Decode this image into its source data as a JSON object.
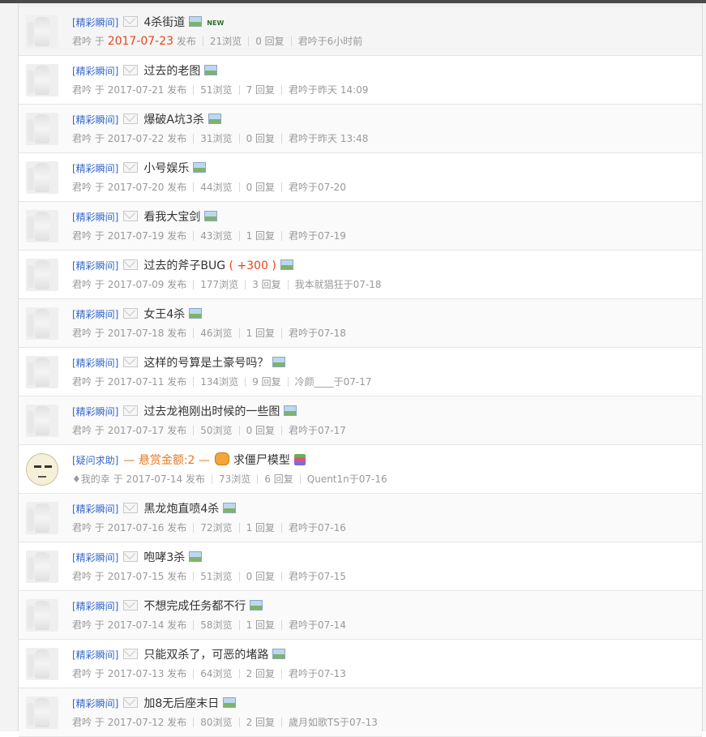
{
  "threads": [
    {
      "tag": "[精彩瞬间]",
      "title": "4杀街道",
      "new_badge": "NEW",
      "author": "君吟",
      "yu": "于",
      "date": "2017-07-23",
      "post_word": "发布",
      "views": "21浏览",
      "replies": "0 回复",
      "last": "君吟于6小时前",
      "icon": "image-icon",
      "hot": true
    },
    {
      "tag": "[精彩瞬间]",
      "title": "过去的老图",
      "author": "君吟",
      "yu": "于",
      "date": "2017-07-21",
      "post_word": "发布",
      "views": "51浏览",
      "replies": "7 回复",
      "last": "君吟于昨天 14:09",
      "icon": "image-icon"
    },
    {
      "tag": "[精彩瞬间]",
      "title": "爆破A坑3杀",
      "author": "君吟",
      "yu": "于",
      "date": "2017-07-22",
      "post_word": "发布",
      "views": "31浏览",
      "replies": "0 回复",
      "last": "君吟于昨天 13:48",
      "icon": "image-icon"
    },
    {
      "tag": "[精彩瞬间]",
      "title": "小号娱乐",
      "author": "君吟",
      "yu": "于",
      "date": "2017-07-20",
      "post_word": "发布",
      "views": "44浏览",
      "replies": "0 回复",
      "last": "君吟于07-20",
      "icon": "image-icon"
    },
    {
      "tag": "[精彩瞬间]",
      "title": "看我大宝剑",
      "author": "君吟",
      "yu": "于",
      "date": "2017-07-19",
      "post_word": "发布",
      "views": "43浏览",
      "replies": "1 回复",
      "last": "君吟于07-19",
      "icon": "image-icon"
    },
    {
      "tag": "[精彩瞬间]",
      "title": "过去的斧子BUG",
      "plus": "( +300 )",
      "author": "君吟",
      "yu": "于",
      "date": "2017-07-09",
      "post_word": "发布",
      "views": "177浏览",
      "replies": "3 回复",
      "last": "我本就猖狂于07-18",
      "icon": "image-icon"
    },
    {
      "tag": "[精彩瞬间]",
      "title": "女王4杀",
      "author": "君吟",
      "yu": "于",
      "date": "2017-07-18",
      "post_word": "发布",
      "views": "46浏览",
      "replies": "1 回复",
      "last": "君吟于07-18",
      "icon": "image-icon"
    },
    {
      "tag": "[精彩瞬间]",
      "title": "这样的号算是土豪号吗？",
      "author": "君吟",
      "yu": "于",
      "date": "2017-07-11",
      "post_word": "发布",
      "views": "134浏览",
      "replies": "9 回复",
      "last": "冷颜____于07-17",
      "icon": "image-icon"
    },
    {
      "tag": "[精彩瞬间]",
      "title": "过去龙袍刚出时候的一些图",
      "author": "君吟",
      "yu": "于",
      "date": "2017-07-17",
      "post_word": "发布",
      "views": "50浏览",
      "replies": "0 回复",
      "last": "君吟于07-17",
      "icon": "image-icon"
    },
    {
      "tag": "[疑问求助]",
      "reward": "— 悬赏金额:2 —",
      "title": "求僵尸模型",
      "author": "♦我的幸",
      "yu": "于",
      "date": "2017-07-14",
      "post_word": "发布",
      "views": "73浏览",
      "replies": "6 回复",
      "last": "Quent1n于07-16",
      "icon": "stack-icon",
      "question": true
    },
    {
      "tag": "[精彩瞬间]",
      "title": "黑龙炮直喷4杀",
      "author": "君吟",
      "yu": "于",
      "date": "2017-07-16",
      "post_word": "发布",
      "views": "72浏览",
      "replies": "1 回复",
      "last": "君吟于07-16",
      "icon": "image-icon"
    },
    {
      "tag": "[精彩瞬间]",
      "title": "咆哮3杀",
      "author": "君吟",
      "yu": "于",
      "date": "2017-07-15",
      "post_word": "发布",
      "views": "51浏览",
      "replies": "0 回复",
      "last": "君吟于07-15",
      "icon": "image-icon"
    },
    {
      "tag": "[精彩瞬间]",
      "title": "不想完成任务都不行",
      "author": "君吟",
      "yu": "于",
      "date": "2017-07-14",
      "post_word": "发布",
      "views": "58浏览",
      "replies": "1 回复",
      "last": "君吟于07-14",
      "icon": "image-icon"
    },
    {
      "tag": "[精彩瞬间]",
      "title": "只能双杀了，可恶的堵路",
      "author": "君吟",
      "yu": "于",
      "date": "2017-07-13",
      "post_word": "发布",
      "views": "64浏览",
      "replies": "2 回复",
      "last": "君吟于07-13",
      "icon": "image-icon"
    },
    {
      "tag": "[精彩瞬间]",
      "title": "加8无后座末日",
      "author": "君吟",
      "yu": "于",
      "date": "2017-07-12",
      "post_word": "发布",
      "views": "80浏览",
      "replies": "2 回复",
      "last": "歲月如歌TS于07-13",
      "icon": "image-icon"
    }
  ]
}
